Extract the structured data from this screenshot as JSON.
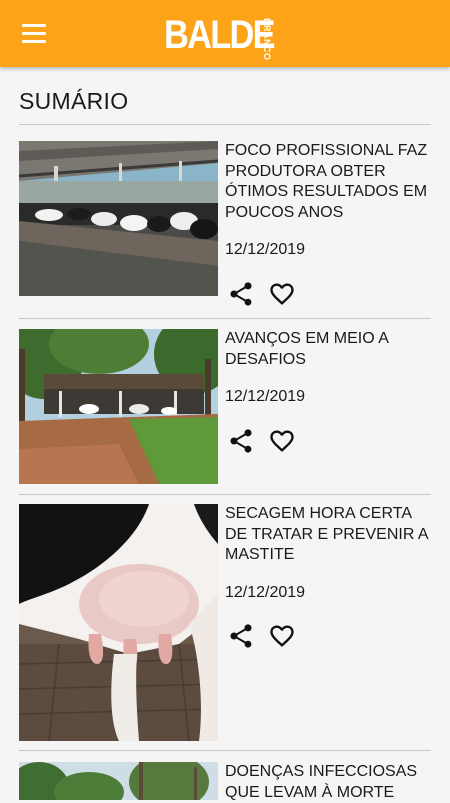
{
  "app": {
    "brand": "BALDE",
    "brand_sub": "BRANCO"
  },
  "page": {
    "title": "SUMÁRIO"
  },
  "articles": [
    {
      "title": "FOCO PROFISSIONAL FAZ PRODUTORA OBTER ÓTIMOS RESULTADOS EM POUCOS ANOS",
      "date": "12/12/2019"
    },
    {
      "title": "AVANÇOS EM MEIO A DESAFIOS",
      "date": "12/12/2019"
    },
    {
      "title": "SECAGEM HORA CERTA DE TRATAR E PREVENIR A MASTITE",
      "date": "12/12/2019"
    },
    {
      "title": "DOENÇAS INFECCIOSAS QUE LEVAM À MORTE",
      "date": ""
    }
  ],
  "colors": {
    "appbar": "#fda318",
    "background": "#f5f5f5",
    "text": "#1a1a1a"
  },
  "icons": {
    "menu": "hamburger-menu-icon",
    "share": "share-icon",
    "favorite": "heart-outline-icon"
  }
}
